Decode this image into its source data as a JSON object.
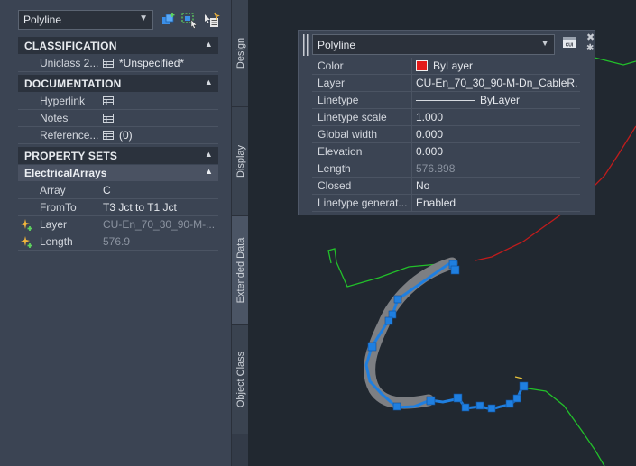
{
  "palette": {
    "object_type": "Polyline",
    "sections": {
      "classification": {
        "title": "CLASSIFICATION",
        "rows": [
          {
            "name": "Uniclass 2...",
            "value": "*Unspecified*"
          }
        ]
      },
      "documentation": {
        "title": "DOCUMENTATION",
        "rows": [
          {
            "name": "Hyperlink",
            "value": ""
          },
          {
            "name": "Notes",
            "value": ""
          },
          {
            "name": "Reference...",
            "value": "(0)"
          }
        ]
      },
      "property_sets": {
        "title": "PROPERTY SETS",
        "subheader": "ElectricalArrays",
        "rows": [
          {
            "name": "Array",
            "value": "C"
          },
          {
            "name": "FromTo",
            "value": "T3 Jct to T1 Jct"
          },
          {
            "name": "Layer",
            "value": "CU-En_70_30_90-M-..."
          },
          {
            "name": "Length",
            "value": "576.9"
          }
        ]
      }
    }
  },
  "tabs": [
    {
      "label": "Design"
    },
    {
      "label": "Display"
    },
    {
      "label": "Extended Data"
    },
    {
      "label": "Object Class"
    }
  ],
  "quick_properties": {
    "object_type": "Polyline",
    "customize_label": "CUI",
    "rows": [
      {
        "name": "Color",
        "value": "ByLayer",
        "swatch_color": "#e41b1b"
      },
      {
        "name": "Layer",
        "value": "CU-En_70_30_90-M-Dn_CableR..."
      },
      {
        "name": "Linetype",
        "value": "ByLayer"
      },
      {
        "name": "Linetype scale",
        "value": "1.000"
      },
      {
        "name": "Global width",
        "value": "0.000"
      },
      {
        "name": "Elevation",
        "value": "0.000"
      },
      {
        "name": "Length",
        "value": "576.898"
      },
      {
        "name": "Closed",
        "value": "No"
      },
      {
        "name": "Linetype  generat...",
        "value": "Enabled"
      }
    ]
  },
  "colors": {
    "selection_blue": "#1f7fe0",
    "green_line": "#22c02a",
    "red_line": "#c01c1c"
  }
}
